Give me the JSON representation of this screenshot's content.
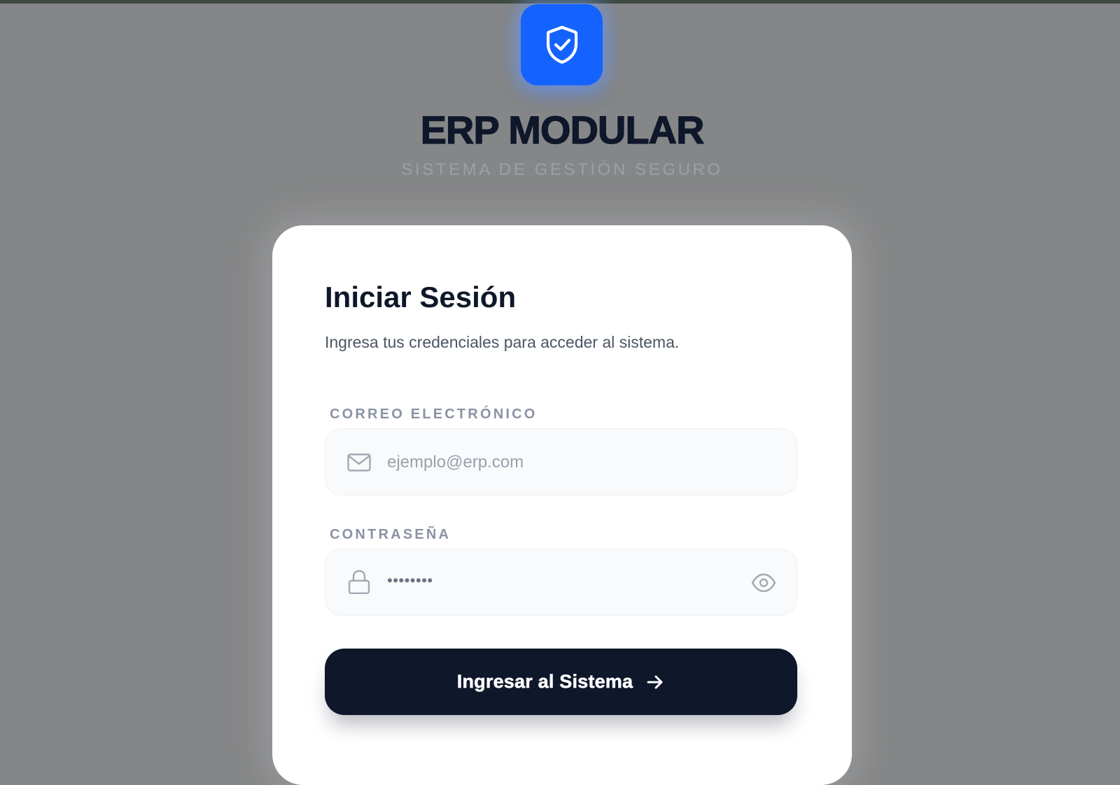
{
  "brand": {
    "title": "ERP MODULAR",
    "subtitle": "SISTEMA DE GESTIÓN SEGURO",
    "logo_icon": "shield-check-icon",
    "accent_color": "#1463ff"
  },
  "login": {
    "title": "Iniciar Sesión",
    "subtitle": "Ingresa tus credenciales para acceder al sistema.",
    "email": {
      "label": "CORREO ELECTRÓNICO",
      "placeholder": "ejemplo@erp.com",
      "icon": "mail-icon"
    },
    "password": {
      "label": "CONTRASEÑA",
      "value": "••••••••",
      "icon": "lock-icon",
      "toggle_icon": "eye-icon"
    },
    "submit": {
      "label": "Ingresar al Sistema",
      "icon": "arrow-right-icon",
      "color": "#0f172a"
    }
  }
}
